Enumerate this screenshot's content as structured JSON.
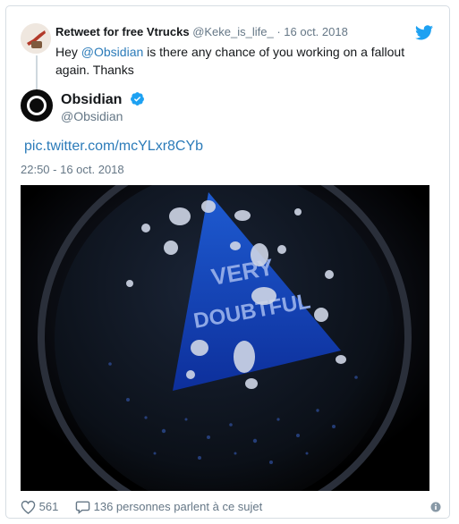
{
  "reply": {
    "name": "Retweet for free Vtrucks",
    "handle": "@Keke_is_life_",
    "date": " · 16 oct. 2018",
    "text_prefix": "Hey ",
    "mention": "@Obsidian",
    "text_suffix": " is there any chance of you working on a fallout again. Thanks"
  },
  "tweet": {
    "name": "Obsidian",
    "handle": "@Obsidian",
    "link": "pic.twitter.com/mcYLxr8CYb",
    "timestamp": "22:50 - 16 oct. 2018",
    "media_text_line1": "VERY",
    "media_text_line2": "DOUBTFUL"
  },
  "footer": {
    "likes": "561",
    "conversation": "136 personnes parlent à ce sujet"
  },
  "icons": {
    "twitter": "twitter-bird-icon",
    "verified": "verified-badge-icon",
    "like": "heart-icon",
    "reply": "speech-bubble-icon",
    "info": "info-icon"
  },
  "colors": {
    "link": "#2b7bb9",
    "muted": "#657786",
    "verified": "#1da1f2"
  }
}
